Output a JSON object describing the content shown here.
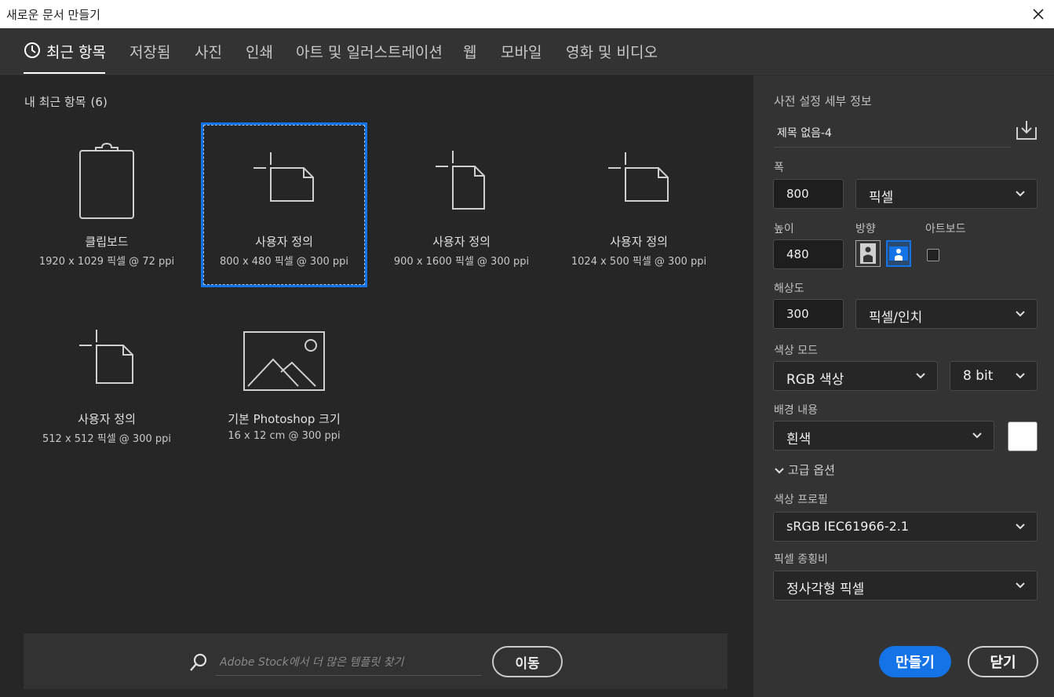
{
  "window": {
    "title": "새로운 문서 만들기"
  },
  "tabs": [
    {
      "label": "최근 항목",
      "active": true
    },
    {
      "label": "저장됨"
    },
    {
      "label": "사진"
    },
    {
      "label": "인쇄"
    },
    {
      "label": "아트 및 일러스트레이션"
    },
    {
      "label": "웹"
    },
    {
      "label": "모바일"
    },
    {
      "label": "영화 및 비디오"
    }
  ],
  "recent": {
    "title": "내 최근 항목",
    "count": "(6)",
    "presets": [
      {
        "icon": "clipboard-icon",
        "name": "클립보드",
        "desc": "1920 x 1029 픽셀 @ 72 ppi"
      },
      {
        "icon": "custom-doc-landscape-icon",
        "name": "사용자 정의",
        "desc": "800 x 480 픽셀 @ 300 ppi",
        "selected": true
      },
      {
        "icon": "custom-doc-portrait-icon",
        "name": "사용자 정의",
        "desc": "900 x 1600 픽셀 @ 300 ppi"
      },
      {
        "icon": "custom-doc-landscape-icon",
        "name": "사용자 정의",
        "desc": "1024 x 500 픽셀 @ 300 ppi"
      },
      {
        "icon": "custom-doc-square-icon",
        "name": "사용자 정의",
        "desc": "512 x 512 픽셀 @ 300 ppi"
      },
      {
        "icon": "image-icon",
        "name": "기본 Photoshop 크기",
        "desc": "16 x 12 cm @ 300 ppi"
      }
    ]
  },
  "stock": {
    "placeholder": "Adobe Stock에서 더 많은 템플릿 찾기",
    "go_label": "이동"
  },
  "details": {
    "header": "사전 설정 세부 정보",
    "doc_name": "제목 없음-4",
    "width_label": "폭",
    "width_value": "800",
    "width_unit": "픽셀",
    "height_label": "높이",
    "height_value": "480",
    "orientation_label": "방향",
    "orientation_selected": "landscape",
    "artboard_label": "아트보드",
    "artboard_checked": false,
    "resolution_label": "해상도",
    "resolution_value": "300",
    "resolution_unit": "픽셀/인치",
    "color_mode_label": "색상 모드",
    "color_mode": "RGB 색상",
    "bit_depth": "8 bit",
    "background_label": "배경 내용",
    "background": "흰색",
    "background_color": "#ffffff",
    "advanced_label": "고급 옵션",
    "color_profile_label": "색상 프로필",
    "color_profile": "sRGB IEC61966-2.1",
    "pixel_aspect_label": "픽셀 종횡비",
    "pixel_aspect": "정사각형 픽셀"
  },
  "actions": {
    "create": "만들기",
    "close": "닫기"
  },
  "colors": {
    "accent": "#1473e6"
  }
}
